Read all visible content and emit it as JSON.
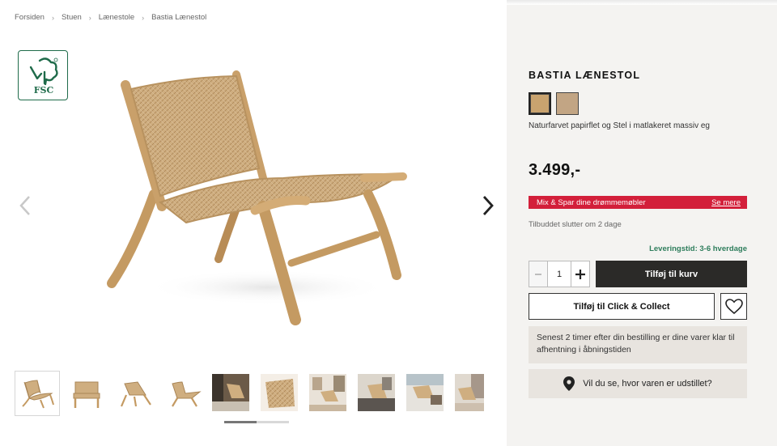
{
  "breadcrumb": {
    "items": [
      "Forsiden",
      "Stuen",
      "Lænestole",
      "Bastia Lænestol"
    ],
    "separator": "›"
  },
  "badge": {
    "text": "FSC",
    "icon": "fsc-tree-icon",
    "color": "#1f6b4a"
  },
  "gallery": {
    "prev_icon": "chevron-left-icon",
    "next_icon": "chevron-right-icon",
    "thumbnail_count": 10,
    "scroll_progress": 0.5
  },
  "product": {
    "brand": "BASTIA",
    "name": "LÆNESTOL",
    "swatches": [
      {
        "color": "#c9a36f",
        "selected": true
      },
      {
        "color": "#c2a584",
        "selected": false
      }
    ],
    "variant_description": "Naturfarvet papirflet og Stel i matlakeret massiv eg",
    "price": "3.499,-",
    "promo": {
      "text": "Mix & Spar dine drømmemøbler",
      "link": "Se mere",
      "color": "#d31f3a"
    },
    "offer_ends": "Tilbuddet slutter om 2 dage",
    "delivery": "Leveringstid: 3-6 hverdage",
    "quantity": "1",
    "add_to_cart": "Tilføj til kurv",
    "click_collect": "Tilføj til Click & Collect",
    "pickup_info": "Senest 2 timer efter din bestilling er dine varer klar til afhentning i åbningstiden",
    "showroom": "Vil du se, hvor varen er udstillet?"
  },
  "colors": {
    "panel_bg": "#f4f3f1",
    "dark_button": "#2b2a28",
    "delivery_green": "#2e7d5c"
  }
}
